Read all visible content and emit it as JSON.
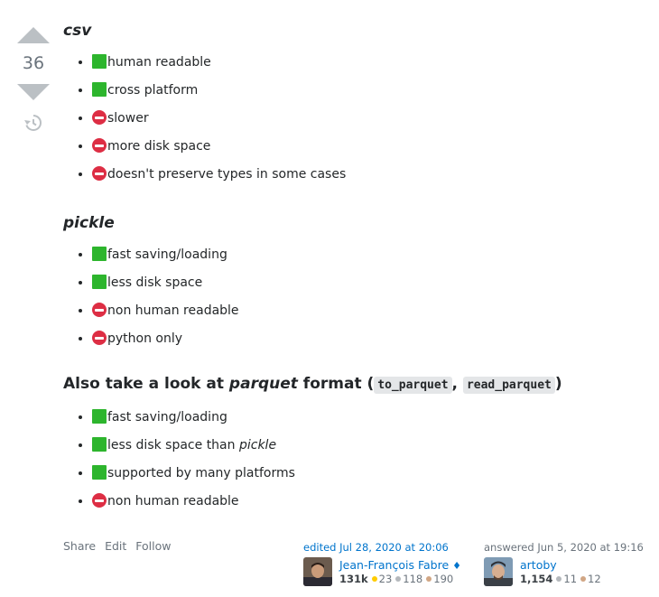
{
  "vote": {
    "score": "36"
  },
  "sections": [
    {
      "title": "csv",
      "items": [
        {
          "status": "ok",
          "text": "human readable"
        },
        {
          "status": "no",
          "text": "cross platform"
        },
        {
          "status": "no",
          "text": "slower"
        },
        {
          "status": "no",
          "text": "more disk space"
        },
        {
          "status": "no",
          "text": "doesn't preserve types in some cases"
        }
      ]
    },
    {
      "title": "pickle",
      "items": [
        {
          "status": "ok",
          "text": "fast saving/loading"
        },
        {
          "status": "ok",
          "text": "less disk space"
        },
        {
          "status": "no",
          "text": "non human readable"
        },
        {
          "status": "no",
          "text": "python only"
        }
      ]
    }
  ],
  "parquet": {
    "title_pre": "Also take a look at ",
    "title_em": "parquet",
    "title_mid": " format (",
    "code1": "to_parquet",
    "sep": ", ",
    "code2": "read_parquet",
    "title_post": ")",
    "items": [
      {
        "status": "ok",
        "text": "fast saving/loading",
        "em": ""
      },
      {
        "status": "ok",
        "text": "less disk space than ",
        "em": "pickle"
      },
      {
        "status": "ok",
        "text": "supported by many platforms",
        "em": ""
      },
      {
        "status": "no",
        "text": "non human readable",
        "em": ""
      }
    ]
  },
  "footer": {
    "actions": [
      "Share",
      "Edit",
      "Follow"
    ],
    "editor": {
      "when": "edited Jul 28, 2020 at 20:06",
      "name": "Jean-François Fabre",
      "diamond": "♦",
      "rep": "131k",
      "gold": "23",
      "silver": "118",
      "bronze": "190"
    },
    "author": {
      "when": "answered Jun 5, 2020 at 19:16",
      "name": "artoby",
      "rep": "1,154",
      "silver": "11",
      "bronze": "12"
    }
  },
  "colors": {
    "ok": "#2db52d",
    "no": "#dd2e44",
    "link": "#0074cc"
  }
}
